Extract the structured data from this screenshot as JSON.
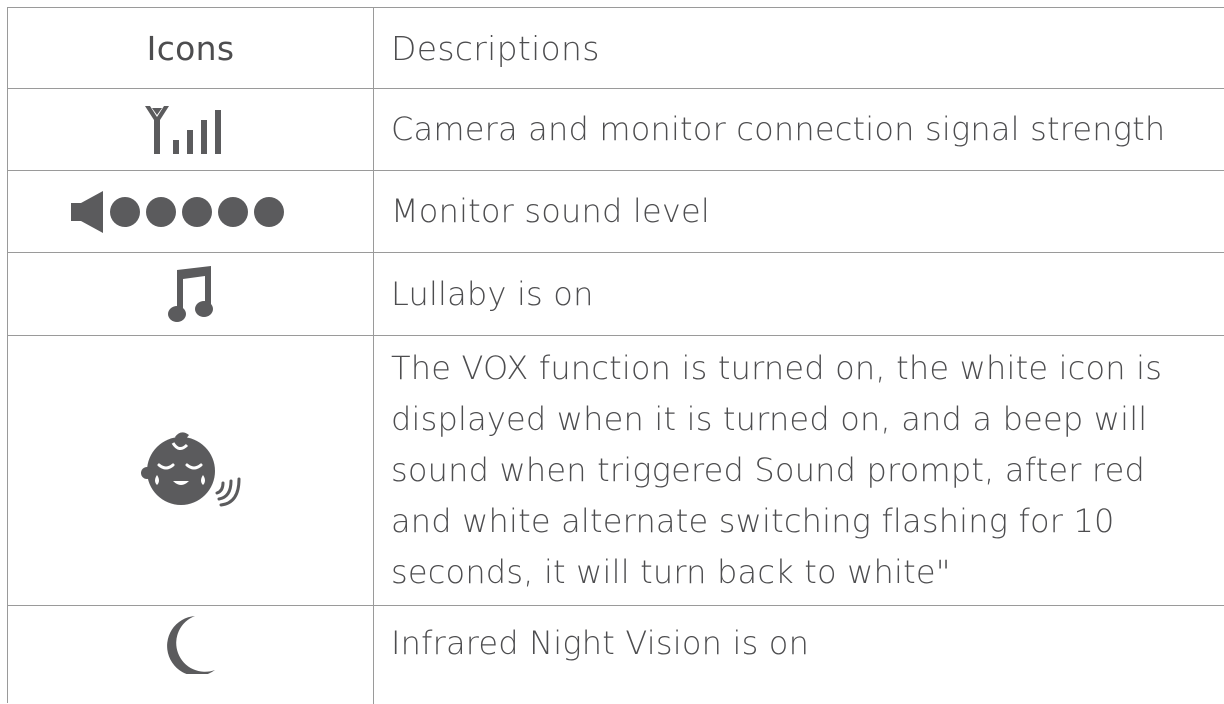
{
  "header": {
    "icons_label": "Icons",
    "descriptions_label": "Descriptions"
  },
  "rows": [
    {
      "icon": "signal-strength-icon",
      "description": "Camera and monitor connection signal strength"
    },
    {
      "icon": "speaker-volume-icon",
      "description": "Monitor sound level"
    },
    {
      "icon": "music-note-icon",
      "description": "Lullaby is on"
    },
    {
      "icon": "baby-vox-icon",
      "description": "The VOX function is turned on, the white icon is\ndisplayed when it is turned on, and a beep will\nsound when triggered Sound prompt, after red\nand white alternate switching flashing for 10\nseconds, it will turn back to white\""
    },
    {
      "icon": "moon-icon",
      "description": "Infrared Night Vision is on"
    }
  ],
  "colors": {
    "icon": "#5b5b5d",
    "text": "#4d4d4f",
    "border": "#9a9a9a"
  }
}
